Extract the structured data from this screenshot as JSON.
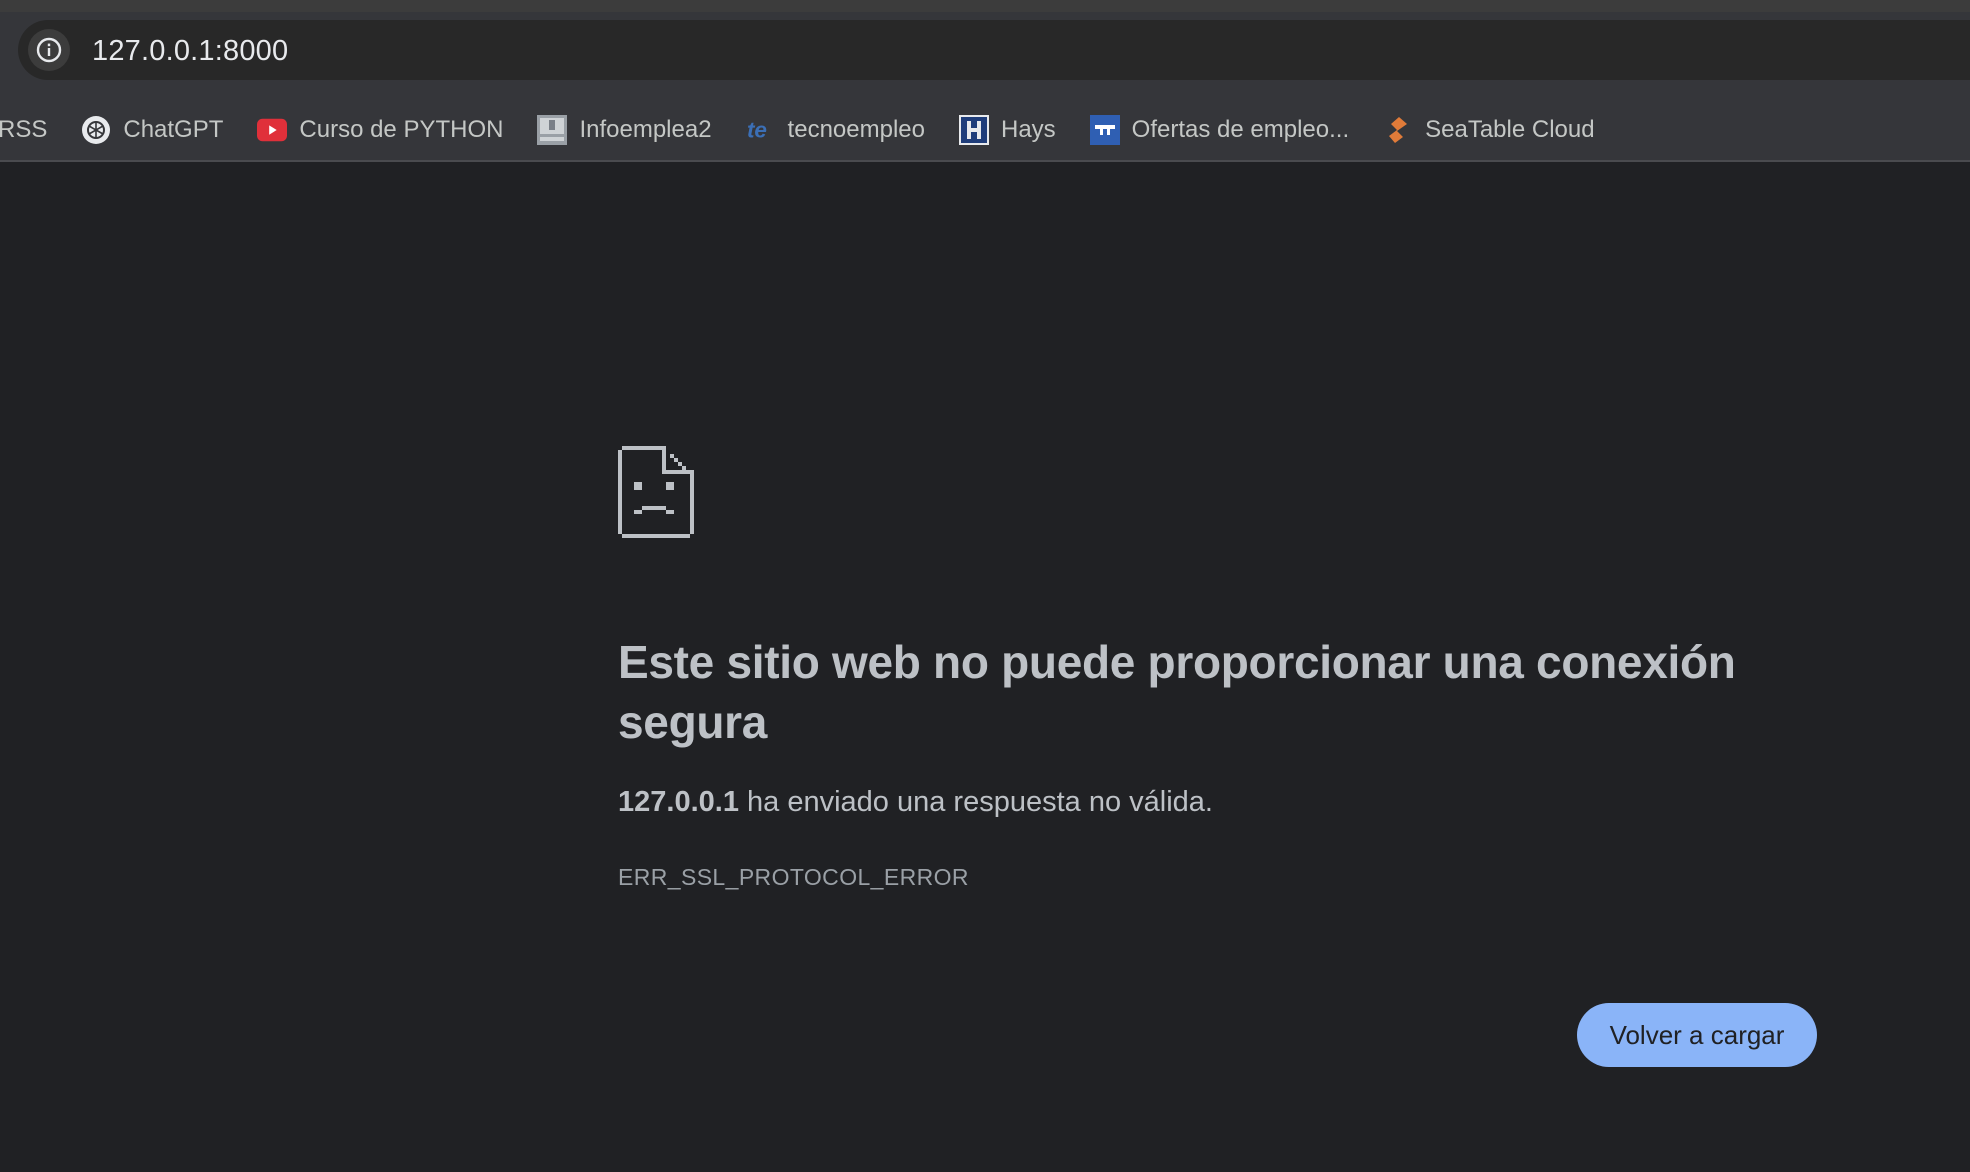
{
  "address_bar": {
    "url": "127.0.0.1:8000"
  },
  "bookmarks": [
    {
      "label": "RSS",
      "icon": "none"
    },
    {
      "label": "ChatGPT",
      "icon": "chatgpt-icon"
    },
    {
      "label": "Curso de PYTHON",
      "icon": "youtube-icon"
    },
    {
      "label": "Infoemplea2",
      "icon": "infoemplea2-icon"
    },
    {
      "label": "tecnoempleo",
      "icon": "tecnoempleo-icon"
    },
    {
      "label": "Hays",
      "icon": "hays-icon"
    },
    {
      "label": "Ofertas de empleo...",
      "icon": "ofertas-icon"
    },
    {
      "label": "SeaTable Cloud",
      "icon": "seatable-icon"
    }
  ],
  "error_page": {
    "icon": "sad-document-icon",
    "headline": "Este sitio web no puede proporcionar una conexión segura",
    "host": "127.0.0.1",
    "message": "ha enviado una respuesta no válida.",
    "error_code": "ERR_SSL_PROTOCOL_ERROR",
    "reload_label": "Volver a cargar"
  },
  "colors": {
    "page_background": "#202124",
    "toolbar_background": "#35363a",
    "button_background": "#8ab4f8",
    "text": "#bdc1c6"
  }
}
